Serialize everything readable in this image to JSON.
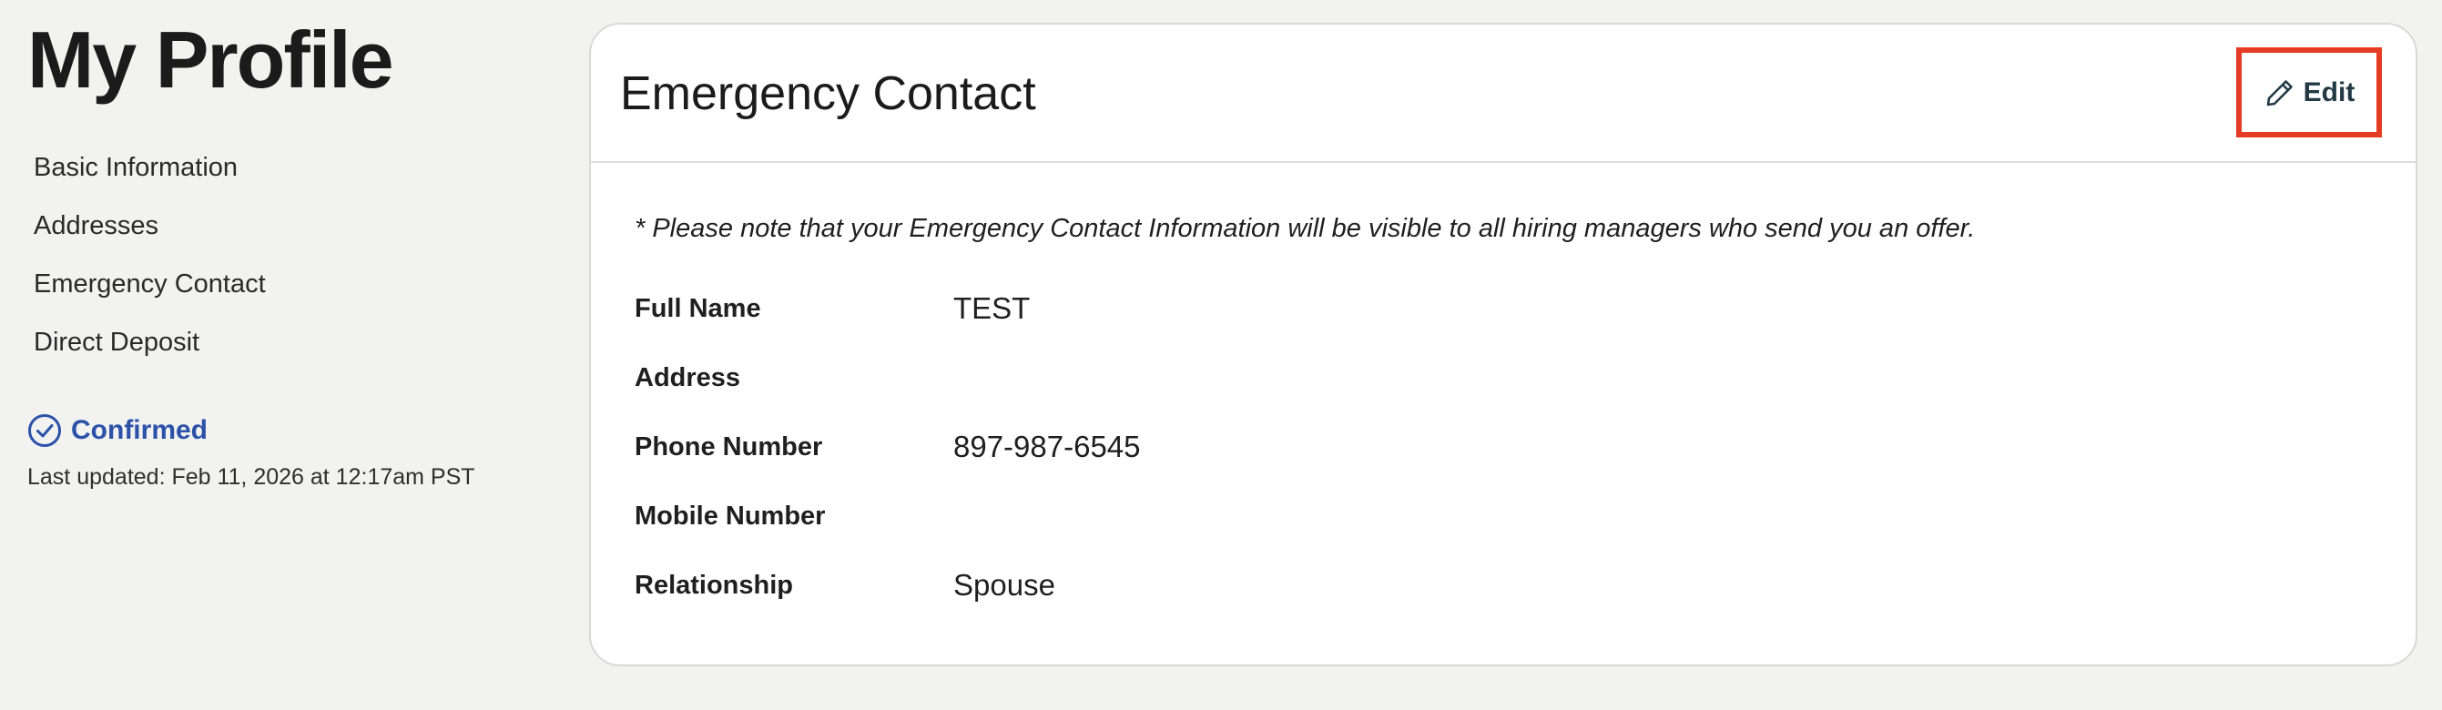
{
  "page": {
    "title": "My Profile"
  },
  "sidebar": {
    "items": [
      {
        "label": "Basic Information"
      },
      {
        "label": "Addresses"
      },
      {
        "label": "Emergency Contact"
      },
      {
        "label": "Direct Deposit"
      }
    ],
    "status": {
      "icon": "check-circle-icon",
      "label": "Confirmed",
      "color": "#2b52a8"
    },
    "last_updated": "Last updated: Feb 11, 2026 at 12:17am PST"
  },
  "card": {
    "title": "Emergency Contact",
    "edit_button": {
      "icon": "pencil-icon",
      "label": "Edit",
      "highlight_color": "#e43c25"
    },
    "notice": "* Please note that your Emergency Contact Information will be visible to all hiring managers who send you an offer.",
    "fields": [
      {
        "label": "Full Name",
        "value": "TEST"
      },
      {
        "label": "Address",
        "value": ""
      },
      {
        "label": "Phone Number",
        "value": "897-987-6545"
      },
      {
        "label": "Mobile Number",
        "value": ""
      },
      {
        "label": "Relationship",
        "value": "Spouse"
      }
    ]
  }
}
